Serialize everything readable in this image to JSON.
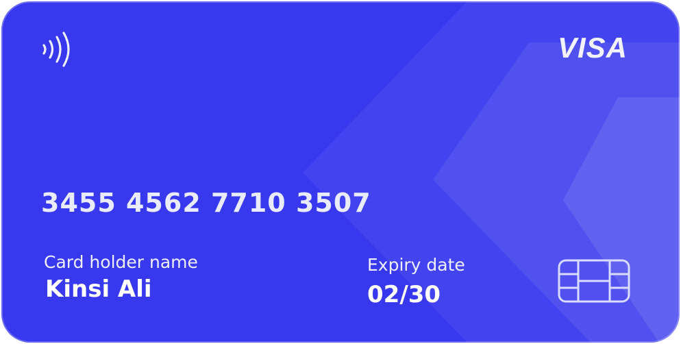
{
  "card": {
    "brand": "VISA",
    "number": "3455 4562 7710 3507",
    "holder_label": "Card holder name",
    "holder_name": "Kinsi Ali",
    "expiry_label": "Expiry date",
    "expiry_value": "02/30"
  },
  "icons": {
    "contactless": "contactless-icon",
    "chip": "chip-icon"
  },
  "colors": {
    "card_base": "#3838ee",
    "text_primary": "#ffffff",
    "text_secondary": "#eef0ff"
  }
}
